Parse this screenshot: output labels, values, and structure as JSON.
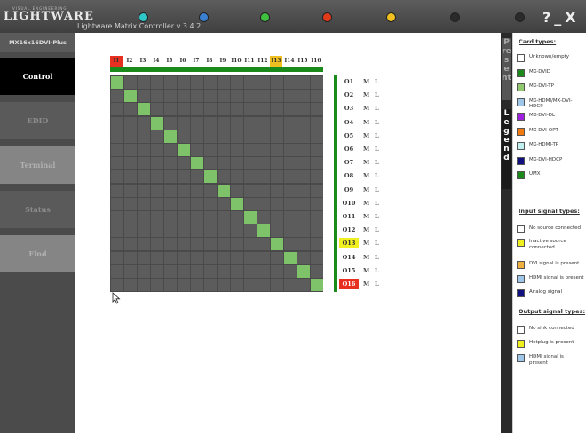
{
  "app": {
    "brand": "LIGHTWARE",
    "brand_tag": "VISUAL ENGINEERING",
    "title": "Lightware Matrix Controller v 3.4.2"
  },
  "status_leds": [
    {
      "name": "led-1",
      "color": "#2ec6c6"
    },
    {
      "name": "led-2",
      "color": "#3a7fd0"
    },
    {
      "name": "led-3",
      "color": "#3fbf3f"
    },
    {
      "name": "led-4",
      "color": "#e03a1a"
    },
    {
      "name": "led-5",
      "color": "#f0c020"
    },
    {
      "name": "led-6",
      "color": "#2a2a2a"
    },
    {
      "name": "led-7",
      "color": "#2a2a2a"
    }
  ],
  "window_buttons": {
    "help": "?",
    "minimize": "_",
    "close": "X"
  },
  "sidebar": {
    "device": "MX16x16DVI-Plus",
    "items": [
      {
        "label": "Control",
        "active": true
      },
      {
        "label": "EDID",
        "active": false
      },
      {
        "label": "Terminal",
        "active": false
      },
      {
        "label": "Status",
        "active": false
      },
      {
        "label": "Find",
        "active": false
      }
    ]
  },
  "matrix": {
    "inputs": [
      "I1",
      "I2",
      "I3",
      "I4",
      "I5",
      "I6",
      "I7",
      "I8",
      "I9",
      "I10",
      "I11",
      "I12",
      "I13",
      "I14",
      "I15",
      "I16"
    ],
    "input_highlight": {
      "I1": "#e83020",
      "I13": "#f0c020"
    },
    "outputs": [
      "O1",
      "O2",
      "O3",
      "O4",
      "O5",
      "O6",
      "O7",
      "O8",
      "O9",
      "O10",
      "O11",
      "O12",
      "O13",
      "O14",
      "O15",
      "O16"
    ],
    "output_highlight": {
      "O13": "#f0f020",
      "O16": "#e83020"
    },
    "mute_label": "M",
    "lock_label": "L",
    "connections": [
      1,
      2,
      3,
      4,
      5,
      6,
      7,
      8,
      9,
      10,
      11,
      12,
      13,
      14,
      15,
      16
    ]
  },
  "legend": {
    "tab_present": "Present",
    "tab_legend": "Legend",
    "card_types_title": "Card types:",
    "card_types": [
      {
        "label": "Unknown/empty",
        "color": "#ffffff"
      },
      {
        "label": "MX-DVID",
        "color": "#1a8a1a"
      },
      {
        "label": "MX-DVI-TP",
        "color": "#90c870"
      },
      {
        "label": "MX-HDMI/MX-DVI-HDCP",
        "color": "#9ec6e8"
      },
      {
        "label": "MX-DVI-DL",
        "color": "#a020e0"
      },
      {
        "label": "MX-DVI-OPT",
        "color": "#f07a10"
      },
      {
        "label": "MX-HDMI-TP",
        "color": "#c0f0f0"
      },
      {
        "label": "MX-DVI-HDCP",
        "color": "#101080"
      },
      {
        "label": "UMX",
        "color": "#1a8a1a"
      }
    ],
    "input_signal_title": "Input signal types:",
    "input_signal_types": [
      {
        "label": "No source connected",
        "color": "#ffffff"
      },
      {
        "label": "Inactive source connected",
        "color": "#f0f020"
      },
      {
        "label": "DVI signal is present",
        "color": "#f0b040"
      },
      {
        "label": "HDMI signal is present",
        "color": "#9ec6e8"
      },
      {
        "label": "Analog signal",
        "color": "#101080"
      }
    ],
    "output_signal_title": "Output signal types:",
    "output_signal_types": [
      {
        "label": "No sink connected",
        "color": "#ffffff"
      },
      {
        "label": "Hotplug is present",
        "color": "#f0f020"
      },
      {
        "label": "HDMI signal is present",
        "color": "#9ec6e8"
      }
    ]
  }
}
